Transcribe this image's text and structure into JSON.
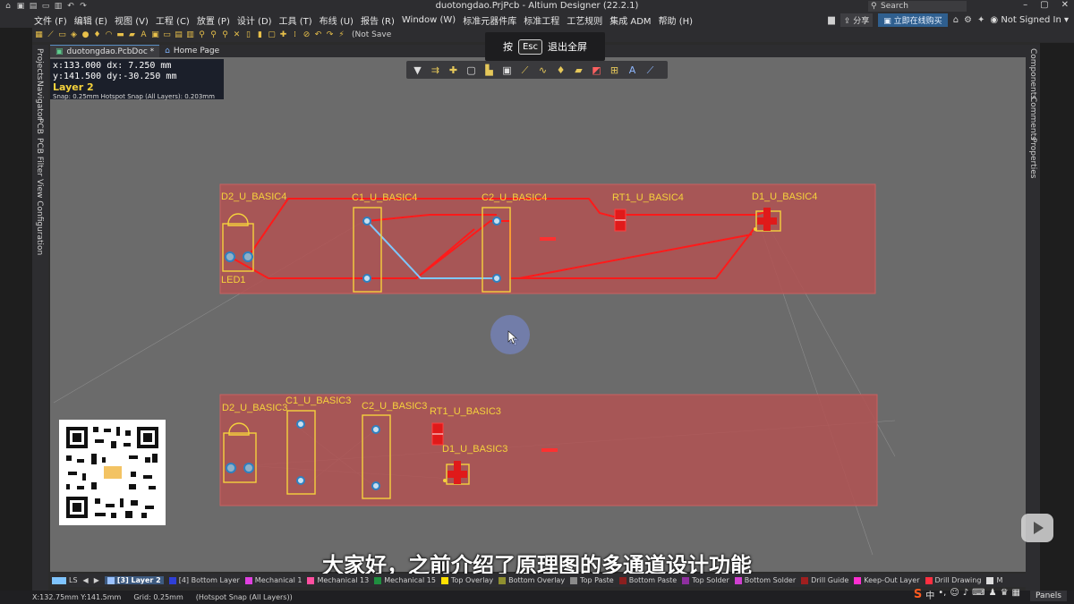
{
  "window": {
    "title": "duotongdao.PrjPcb - Altium Designer (22.2.1)",
    "search_placeholder": "Search",
    "controls": [
      "–",
      "▢",
      "✕"
    ]
  },
  "menu": {
    "items": [
      "文件 (F)",
      "编辑 (E)",
      "视图 (V)",
      "工程 (C)",
      "放置 (P)",
      "设计 (D)",
      "工具 (T)",
      "布线 (U)",
      "报告 (R)",
      "Window (W)",
      "标准元器件库",
      "标准工程",
      "工艺规则",
      "集成 ADM",
      "帮助 (H)"
    ],
    "share": "分享",
    "buy": "立即在线购买",
    "user": "Not Signed In"
  },
  "toolbar": {
    "not_saved": "(Not Save"
  },
  "esc_hint": {
    "press": "按",
    "key": "Esc",
    "action": "退出全屏"
  },
  "left_panels": [
    "Projects",
    "Navigator",
    "PCB",
    "PCB Filter",
    "View Configuration"
  ],
  "right_panels": [
    "Components",
    "Comments",
    "Properties"
  ],
  "doc_tabs": [
    {
      "label": "duotongdao.PcbDoc *",
      "active": true
    },
    {
      "label": "Home Page",
      "active": false
    }
  ],
  "coords": {
    "line1": "x:133.000  dx:  7.250  mm",
    "line2": "y:141.500  dy:-30.250 mm",
    "layer": "Layer 2",
    "snap": "Snap: 0.25mm Hotspot Snap (All Layers): 0.203mm"
  },
  "designators": {
    "ch4": [
      "D2_U_BASIC4",
      "C1_U_BASIC4",
      "C2_U_BASIC4",
      "RT1_U_BASIC4",
      "D1_U_BASIC4",
      "LED1"
    ],
    "ch3": [
      "D2_U_BASIC3",
      "C1_U_BASIC3",
      "C2_U_BASIC3",
      "RT1_U_BASIC3",
      "D1_U_BASIC3"
    ]
  },
  "subtitle": "大家好，之前介绍了原理图的多通道设计功能",
  "layers": [
    {
      "name": "LS",
      "color": "#7fc4ff"
    },
    {
      "name": "[3] Layer 2",
      "color": "#9bc2ff",
      "current": true
    },
    {
      "name": "[4] Bottom Layer",
      "color": "#2f3fd6"
    },
    {
      "name": "Mechanical 1",
      "color": "#e040e0"
    },
    {
      "name": "Mechanical 13",
      "color": "#ff4fa0"
    },
    {
      "name": "Mechanical 15",
      "color": "#1f8f3f"
    },
    {
      "name": "Top Overlay",
      "color": "#ffe000"
    },
    {
      "name": "Bottom Overlay",
      "color": "#8f8f2f"
    },
    {
      "name": "Top Paste",
      "color": "#8a8a8a"
    },
    {
      "name": "Bottom Paste",
      "color": "#8a1f1f"
    },
    {
      "name": "Top Solder",
      "color": "#8f2f9f"
    },
    {
      "name": "Bottom Solder",
      "color": "#d040d0"
    },
    {
      "name": "Drill Guide",
      "color": "#a01f1f"
    },
    {
      "name": "Keep-Out Layer",
      "color": "#ff2fd0"
    },
    {
      "name": "Drill Drawing",
      "color": "#ff2f40"
    },
    {
      "name": "M",
      "color": "#dddddd"
    }
  ],
  "status": {
    "pos": "X:132.75mm Y:141.5mm",
    "grid": "Grid: 0.25mm",
    "snap": "(Hotspot Snap (All Layers))",
    "panels": "Panels"
  },
  "colors": {
    "board_fill": "#b15252",
    "overlay": "#f5d23c",
    "track_top": "#ff1a1a",
    "track_l2": "#7ec8ff",
    "canvas": "#6b6b6b"
  }
}
